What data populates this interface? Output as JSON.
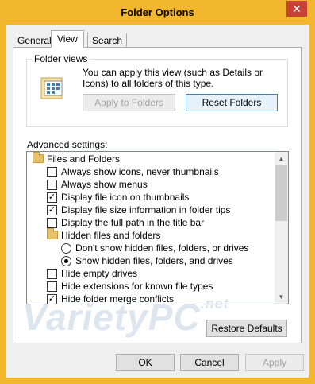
{
  "window": {
    "title": "Folder Options",
    "close_glyph": "✕",
    "frame_color": "#f2b72e"
  },
  "tabs": [
    {
      "label": "General",
      "active": false
    },
    {
      "label": "View",
      "active": true
    },
    {
      "label": "Search",
      "active": false
    }
  ],
  "folder_views": {
    "legend": "Folder views",
    "icon": "folder-view-icon",
    "description": "You can apply this view (such as Details or Icons) to all folders of this type.",
    "apply_label": "Apply to Folders",
    "reset_label": "Reset Folders"
  },
  "advanced": {
    "label": "Advanced settings:",
    "items": [
      {
        "kind": "folder",
        "label": "Files and Folders"
      },
      {
        "kind": "checkbox",
        "label": "Always show icons, never thumbnails",
        "checked": false
      },
      {
        "kind": "checkbox",
        "label": "Always show menus",
        "checked": false
      },
      {
        "kind": "checkbox",
        "label": "Display file icon on thumbnails",
        "checked": true
      },
      {
        "kind": "checkbox",
        "label": "Display file size information in folder tips",
        "checked": true
      },
      {
        "kind": "checkbox",
        "label": "Display the full path in the title bar",
        "checked": false
      },
      {
        "kind": "folder",
        "label": "Hidden files and folders"
      },
      {
        "kind": "radio",
        "label": "Don't show hidden files, folders, or drives",
        "selected": false
      },
      {
        "kind": "radio",
        "label": "Show hidden files, folders, and drives",
        "selected": true
      },
      {
        "kind": "checkbox",
        "label": "Hide empty drives",
        "checked": false
      },
      {
        "kind": "checkbox",
        "label": "Hide extensions for known file types",
        "checked": false
      },
      {
        "kind": "checkbox",
        "label": "Hide folder merge conflicts",
        "checked": true
      }
    ]
  },
  "watermark": {
    "text": "VarietyPC",
    "suffix": ".net"
  },
  "buttons": {
    "restore": "Restore Defaults",
    "ok": "OK",
    "cancel": "Cancel",
    "apply": "Apply"
  }
}
